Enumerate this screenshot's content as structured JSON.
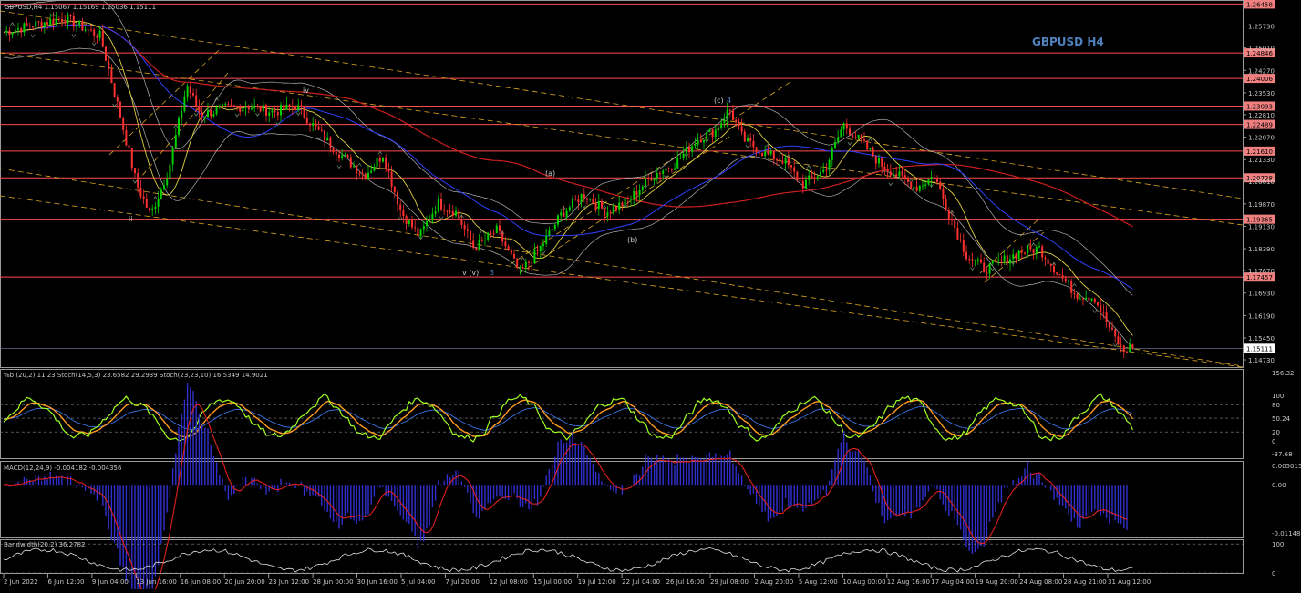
{
  "main": {
    "info_line": "GBPUSD,H4  1.15067 1.15169 1.15036 1.15111",
    "title": "GBPUSD H4",
    "title_color": "#4f81bd",
    "price_ticks": [
      "1.25730",
      "1.25010",
      "1.24270",
      "1.23530",
      "1.22810",
      "1.22070",
      "1.21330",
      "1.20610",
      "1.19870",
      "1.19130",
      "1.18390",
      "1.17670",
      "1.16930",
      "1.16190",
      "1.15450",
      "1.14730"
    ],
    "levels": [
      "1.26458",
      "1.24846",
      "1.24006",
      "1.23093",
      "1.22489",
      "1.21610",
      "1.20728",
      "1.19365",
      "1.17457"
    ],
    "current_price": "1.15111",
    "wave_labels": {
      "ii": "ii",
      "iv": "iv",
      "v_v": "v (v)",
      "three": "3",
      "a": "(a)",
      "b": "(b)",
      "c": "(c)",
      "four": "4"
    }
  },
  "stoch": {
    "header": "%b (20,2) 11.23  Stoch(14,5,3) 23.6582 29.2939  Stoch(23,23,10) 16.5349 14.9021",
    "ticks": [
      "156.32",
      "100",
      "80",
      "50.24",
      "20",
      "0",
      "-37.68"
    ]
  },
  "macd": {
    "header": "MACD(12,24,9) -0.004182 -0.004356",
    "ticks": [
      "0.005015",
      "0.00",
      "-0.011489"
    ]
  },
  "bandwidth": {
    "header": "Bandwidth(20,2) 36.2782",
    "ticks": [
      "100",
      "0"
    ]
  },
  "time_axis": [
    "2 Jun 2022",
    "6 Jun 12:00",
    "9 Jun 04:00",
    "13 Jun 16:00",
    "16 Jun 08:00",
    "20 Jun 20:00",
    "23 Jun 12:00",
    "28 Jun 00:00",
    "30 Jun 16:00",
    "5 Jul 04:00",
    "7 Jul 20:00",
    "12 Jul 08:00",
    "15 Jul 00:00",
    "19 Jul 12:00",
    "22 Jul 04:00",
    "26 Jul 16:00",
    "29 Jul 08:00",
    "2 Aug 20:00",
    "5 Aug 12:00",
    "10 Aug 00:00",
    "12 Aug 16:00",
    "17 Aug 04:00",
    "19 Aug 20:00",
    "24 Aug 08:00",
    "28 Aug 21:00",
    "31 Aug 12:00"
  ],
  "colors": {
    "bull": "#00d000",
    "bear": "#ff3030",
    "level_line": "#ff4d4d",
    "level_label_bg": "#f08080",
    "current_label_bg": "#ffffff",
    "channel": "#daa520",
    "sma_red": "#cc1f1f",
    "sma_blue": "#3040ff",
    "sma_yellow": "#e0d040",
    "bb": "#b0b0b0",
    "stoch_main": "#a0ff20",
    "stoch_slow": "#ff9a20",
    "stoch_sig": "#4080ff",
    "macd_hist": "#3030d0",
    "macd_sig": "#e02020"
  }
}
